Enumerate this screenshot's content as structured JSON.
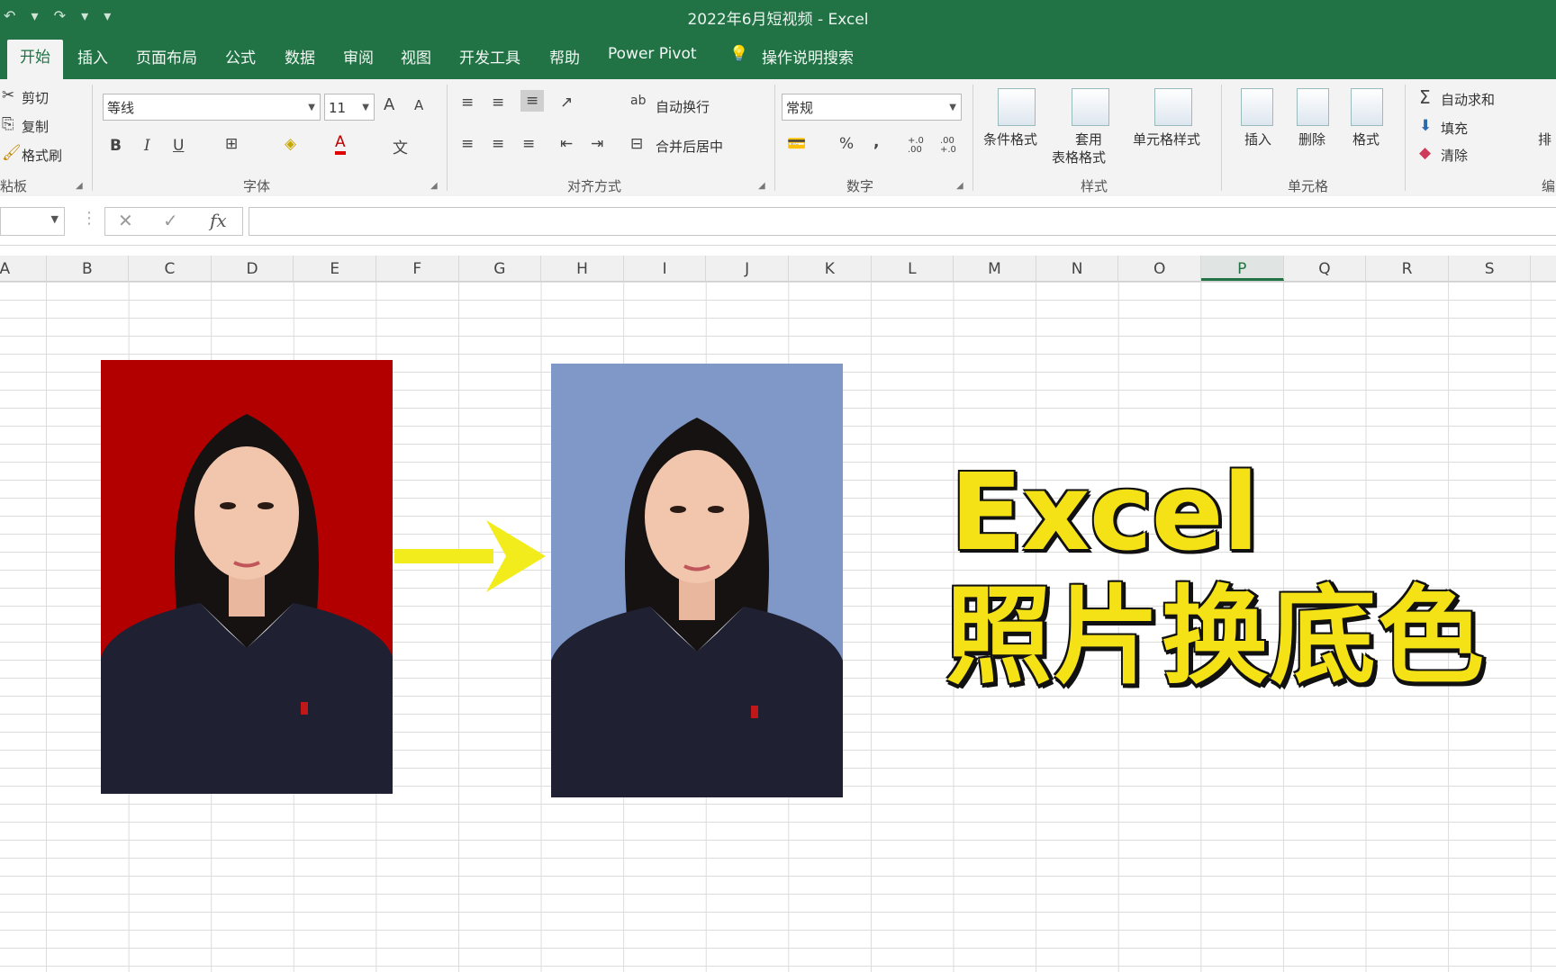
{
  "window": {
    "title": "2022年6月短视频 - Excel",
    "quick_access": "↶ ▾ ↷ ▾ ▾"
  },
  "tabs": [
    {
      "label": "开始",
      "active": true
    },
    {
      "label": "插入"
    },
    {
      "label": "页面布局"
    },
    {
      "label": "公式"
    },
    {
      "label": "数据"
    },
    {
      "label": "审阅"
    },
    {
      "label": "视图"
    },
    {
      "label": "开发工具"
    },
    {
      "label": "帮助"
    },
    {
      "label": "Power Pivot"
    },
    {
      "label": "操作说明搜索"
    }
  ],
  "ribbon": {
    "clipboard": {
      "cut": "剪切",
      "copy": "复制",
      "format_painter": "格式刷",
      "label": "粘板"
    },
    "font": {
      "name": "等线",
      "size": "11",
      "label": "字体",
      "bold": "B",
      "italic": "I",
      "underline": "U",
      "grow": "A",
      "shrink": "A",
      "wen": "文"
    },
    "alignment": {
      "wrap": "自动换行",
      "merge": "合并后居中",
      "label": "对齐方式"
    },
    "number": {
      "format": "常规",
      "percent": "%",
      "comma": ",",
      "inc": "+.0 .00",
      "dec": ".00 +.0",
      "label": "数字"
    },
    "styles": {
      "conditional": "条件格式",
      "table_line1": "套用",
      "table_line2": "表格格式",
      "cell_styles": "单元格样式",
      "label": "样式"
    },
    "cells": {
      "insert": "插入",
      "delete": "删除",
      "format": "格式",
      "label": "单元格"
    },
    "editing": {
      "autosum": "自动求和",
      "fill": "填充",
      "clear": "清除",
      "sort": "排",
      "label": "编"
    }
  },
  "formula_bar": {
    "cancel": "✕",
    "enter": "✓",
    "fx": "fx",
    "value": ""
  },
  "columns": [
    "A",
    "B",
    "C",
    "D",
    "E",
    "F",
    "G",
    "H",
    "I",
    "J",
    "K",
    "L",
    "M",
    "N",
    "O",
    "P",
    "Q",
    "R",
    "S"
  ],
  "selected_column": "P",
  "overlay": {
    "title": "Excel",
    "subtitle": "照片换底色"
  },
  "colors": {
    "excel_green": "#217346",
    "photo_before_bg": "#b20000",
    "photo_after_bg": "#7f98c8",
    "arrow": "#f3ec1c",
    "overlay_text": "#f4e217"
  }
}
